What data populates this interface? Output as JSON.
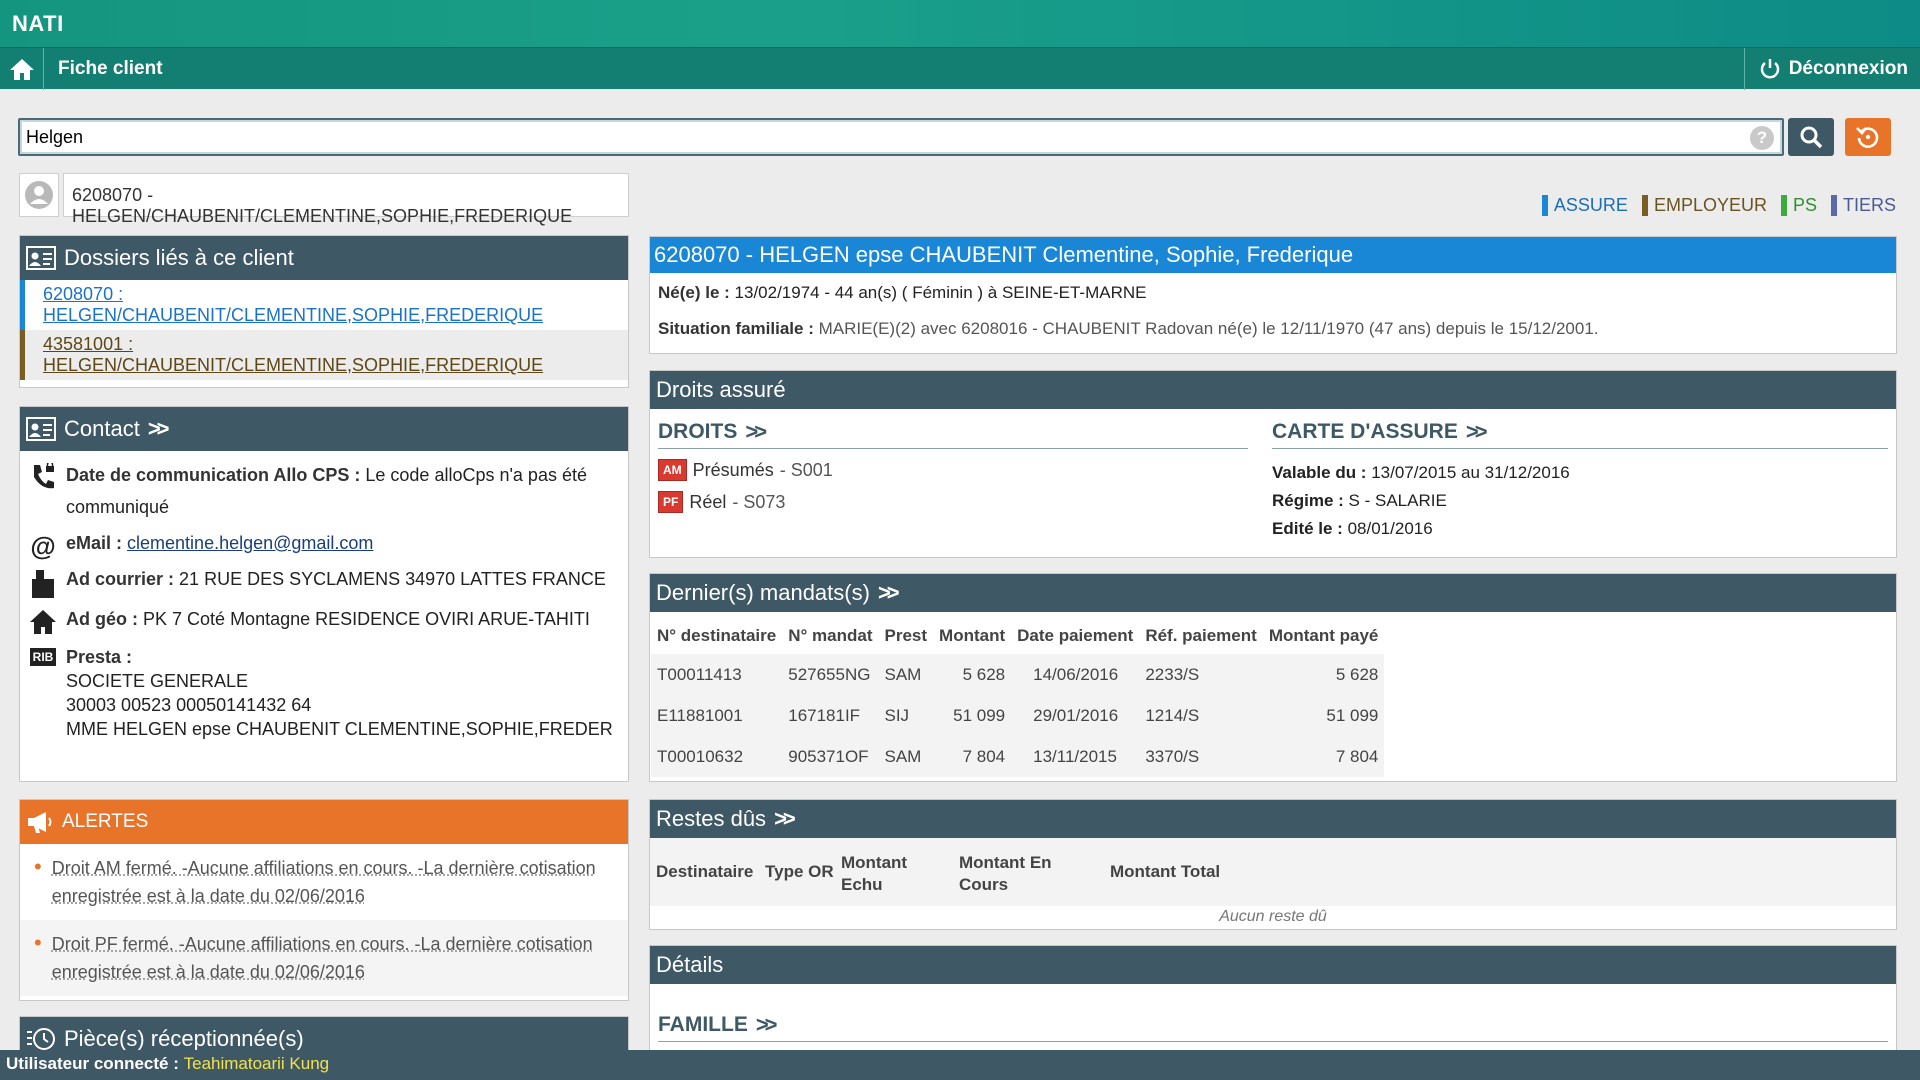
{
  "app": {
    "brand": "NATI"
  },
  "nav": {
    "title": "Fiche client",
    "logout_label": "Déconnexion"
  },
  "search": {
    "value": "Helgen",
    "help": "?"
  },
  "client_select": {
    "value": "6208070 - HELGEN/CHAUBENIT/CLEMENTINE,SOPHIE,FREDERIQUE"
  },
  "legend": {
    "assure": "ASSURE",
    "employeur": "EMPLOYEUR",
    "ps": "PS",
    "tiers": "TIERS"
  },
  "dossiers": {
    "title": "Dossiers liés à ce client",
    "items": [
      "6208070 : HELGEN/CHAUBENIT/CLEMENTINE,SOPHIE,FREDERIQUE",
      "43581001 : HELGEN/CHAUBENIT/CLEMENTINE,SOPHIE,FREDERIQUE"
    ]
  },
  "contact": {
    "title": "Contact",
    "allo_label": "Date de communication Allo CPS :",
    "allo_value": "Le code alloCps n'a pas été communiqué",
    "email_label": "eMail :",
    "email_value": "clementine.helgen@gmail.com",
    "courrier_label": "Ad courrier :",
    "courrier_value": "21 RUE DES SYCLAMENS 34970 LATTES FRANCE",
    "geo_label": "Ad géo :",
    "geo_value": "PK 7 Coté Montagne RESIDENCE OVIRI ARUE-TAHITI",
    "presta_label": "Presta :",
    "presta_lines": [
      "SOCIETE GENERALE",
      "30003 00523 00050141432 64",
      "MME HELGEN epse CHAUBENIT CLEMENTINE,SOPHIE,FREDER"
    ]
  },
  "alertes": {
    "title": "ALERTES",
    "items": [
      "Droit AM fermé. -Aucune affiliations en cours. -La dernière cotisation enregistrée est à la date du 02/06/2016",
      "Droit PF fermé. -Aucune affiliations en cours. -La dernière cotisation enregistrée est à la date du 02/06/2016"
    ]
  },
  "pieces": {
    "title": "Pièce(s) réceptionnée(s)"
  },
  "client": {
    "header": "6208070 - HELGEN epse CHAUBENIT Clementine, Sophie, Frederique",
    "born_label": "Né(e) le :",
    "born_value": "13/02/1974 - 44 an(s) ( Féminin ) à SEINE-ET-MARNE",
    "situation_label": "Situation familiale :",
    "situation_value": "MARIE(E)(2) avec 6208016 - CHAUBENIT Radovan né(e) le 12/11/1970 (47 ans) depuis le 15/12/2001."
  },
  "droits": {
    "title": "Droits assuré",
    "droits_title": "DROITS",
    "rows": [
      {
        "badge": "AM",
        "label": "Présumés",
        "code": "- S001"
      },
      {
        "badge": "PF",
        "label": "Réel",
        "code": "- S073"
      }
    ],
    "carte_title": "CARTE D'ASSURE",
    "valable_label": "Valable du :",
    "valable_value": "13/07/2015 au 31/12/2016",
    "regime_label": "Régime :",
    "regime_value": "S - SALARIE",
    "edite_label": "Edité le :",
    "edite_value": "08/01/2016"
  },
  "mandats": {
    "title": "Dernier(s) mandats(s)",
    "columns": [
      "N° destinataire",
      "N° mandat",
      "Prest",
      "Montant",
      "Date paiement",
      "Réf. paiement",
      "Montant payé"
    ],
    "rows": [
      [
        "T00011413",
        "527655NG",
        "SAM",
        "5 628",
        "14/06/2016",
        "2233/S",
        "5 628"
      ],
      [
        "E11881001",
        "167181IF",
        "SIJ",
        "51 099",
        "29/01/2016",
        "1214/S",
        "51 099"
      ],
      [
        "T00010632",
        "905371OF",
        "SAM",
        "7 804",
        "13/11/2015",
        "3370/S",
        "7 804"
      ]
    ]
  },
  "restes": {
    "title": "Restes dûs",
    "columns": [
      "Destinataire",
      "Type OR",
      "Montant Echu",
      "Montant En Cours",
      "Montant Total"
    ],
    "empty": "Aucun reste dû"
  },
  "details": {
    "title": "Détails",
    "famille_title": "FAMILLE"
  },
  "footer": {
    "label": "Utilisateur connecté :",
    "user": "Teahimatoarii Kung"
  }
}
